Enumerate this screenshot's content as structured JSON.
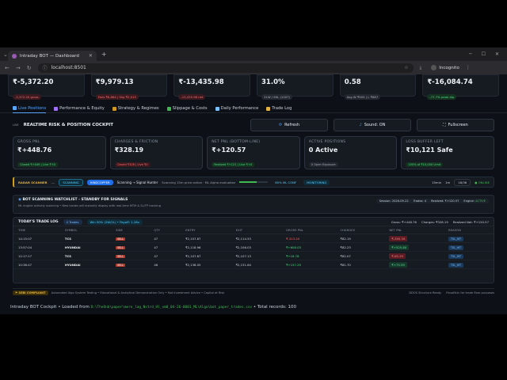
{
  "browser": {
    "tab_title": "Intraday BOT — Dashboard",
    "url": "localhost:8501",
    "mode": "Incognito"
  },
  "kpi_top": [
    {
      "value": "₹-5,372.20",
      "sub": "-5,372.20 gross",
      "tone": "red"
    },
    {
      "value": "₹9,979.13",
      "sub": "Fees ₹6,864 | Slip ₹2,915",
      "tone": "red"
    },
    {
      "value": "₹-13,435.98",
      "sub": "-13,435.98 net",
      "tone": "red"
    },
    {
      "value": "31.0%",
      "sub": "31W / 69L (100T)",
      "tone": "gry"
    },
    {
      "value": "0.58",
      "sub": "Avg W ₹905 | L ₹687",
      "tone": "gry"
    },
    {
      "value": "₹-16,084.74",
      "sub": "-77.7% peak dip",
      "tone": "grn"
    }
  ],
  "tabs": [
    "Live Positions",
    "Performance & Equity",
    "Strategy & Regimes",
    "Slippage & Costs",
    "Daily Performance",
    "Trade Log"
  ],
  "cockpit": {
    "live": "LIVE",
    "title": "REALTIME RISK & POSITION COCKPIT",
    "refresh": "Refresh",
    "sound": "Sound: ON",
    "fullscreen": "Fullscreen"
  },
  "kpi2": [
    {
      "label": "GROSS PNL",
      "value": "₹+448.76",
      "pill": "Closed ₹+449 | Live ₹+0",
      "tone": "grn"
    },
    {
      "label": "CHARGES & FRICTION",
      "value": "₹328.19",
      "pill": "Closed ₹328 | Live ₹0",
      "tone": "red"
    },
    {
      "label": "NET PNL (BOTTOM-LINE)",
      "value": "₹+120.57",
      "pill": "Realized ₹+121 | Live ₹+0",
      "tone": "grn"
    },
    {
      "label": "ACTIVE POSITIONS",
      "value": "0 Active",
      "pill": "0 Open Exposure",
      "tone": "gry"
    },
    {
      "label": "LOSS BUFFER LEFT",
      "value": "₹10,121 Safe",
      "pill": "100% of ₹10,000 Limit",
      "tone": "grn"
    }
  ],
  "scanner": {
    "label": "RADAR SCANNER",
    "dots": "....",
    "status": "SCANNING",
    "symbol": "HINDCOPPER",
    "flow": "Scanning → Signal Hunter",
    "text": "Scanning 15m price action · ML Alpha evaluation",
    "conf": "60% ML CONF",
    "monitor": "MONITORING",
    "conf_fraction": 0.6,
    "interval1": "15min",
    "interval2": "1m",
    "count": "18/36",
    "online": "ONLINE"
  },
  "watchlist": {
    "title": "BOT SCANNING WATCHLIST - STANDBY FOR SIGNALS",
    "sub": "ML engine actively scanning • New trades will instantly display with real-time MTM & SL/TP tracking",
    "session": "Session: 2026-09-22",
    "trades": "Trades: 4",
    "realized": "Realized: ₹+120.57",
    "engine": "Engine:",
    "engine_state": "ACTIVE"
  },
  "tradelog": {
    "title": "TODAY'S TRADE LOG",
    "count": "4 Trades",
    "win": "Win 50% (2W/2L) • Payoff: 1.28x",
    "gross": "Gross: ₹+448.76",
    "charges": "Charges: ₹328.19",
    "net": "Realized Net: ₹+120.57",
    "columns": [
      "TIME",
      "SYMBOL",
      "SIDE",
      "QTY",
      "ENTRY",
      "EXIT",
      "GROSS PNL",
      "CHARGES",
      "NET PNL",
      "REASON"
    ],
    "rows": [
      {
        "time": "14:15:07",
        "symbol": "TCS",
        "side": "SELL",
        "qty": "47",
        "entry": "₹2,107.87",
        "exit": "₹2,114.53",
        "gross": "₹-313.20",
        "charges": "₹82.19",
        "net": "₹-395.39",
        "reason": "TSL_HIT",
        "sign": "neg"
      },
      {
        "time": "13:57:04",
        "symbol": "HYUNDAI",
        "side": "SELL",
        "qty": "47",
        "entry": "₹2,118.96",
        "exit": "₹2,106.03",
        "gross": "₹+608.03",
        "charges": "₹82.23",
        "net": "₹+525.80",
        "reason": "TSL_HIT",
        "sign": "pos"
      },
      {
        "time": "12:17:17",
        "symbol": "TCS",
        "side": "SELL",
        "qty": "47",
        "entry": "₹2,107.87",
        "exit": "₹2,107.13",
        "gross": "₹+16.78",
        "charges": "₹82.07",
        "net": "₹-65.29",
        "reason": "TSL_HIT",
        "sign": "neg"
      },
      {
        "time": "10:38:47",
        "symbol": "HYUNDAI",
        "side": "SELL",
        "qty": "46",
        "entry": "₹2,138.05",
        "exit": "₹2,131.64",
        "gross": "₹+157.29",
        "charges": "₹81.70",
        "net": "₹+75.59",
        "reason": "TSL_HIT",
        "sign": "pos"
      }
    ]
  },
  "footer": {
    "badge": "SEBI COMPLIANT",
    "text": "Automated Algo System Testing • Educational & Analytical Demonstration Only • Not Investment Advice • Capital at Risk",
    "right1": "DDOS Structure Ready",
    "right2": "FinsoftLtc for trade floor purposes"
  },
  "caption": {
    "prefix": "Intraday BOT Cockpit • Loaded from",
    "path": "D:\\TheOnb\\paper\\mere_lag_Nstrd_Hl_vm0_04-26-0001_ML\\Algo\\bot_paper_trades.csv",
    "suffix": "• Total records: 100"
  }
}
